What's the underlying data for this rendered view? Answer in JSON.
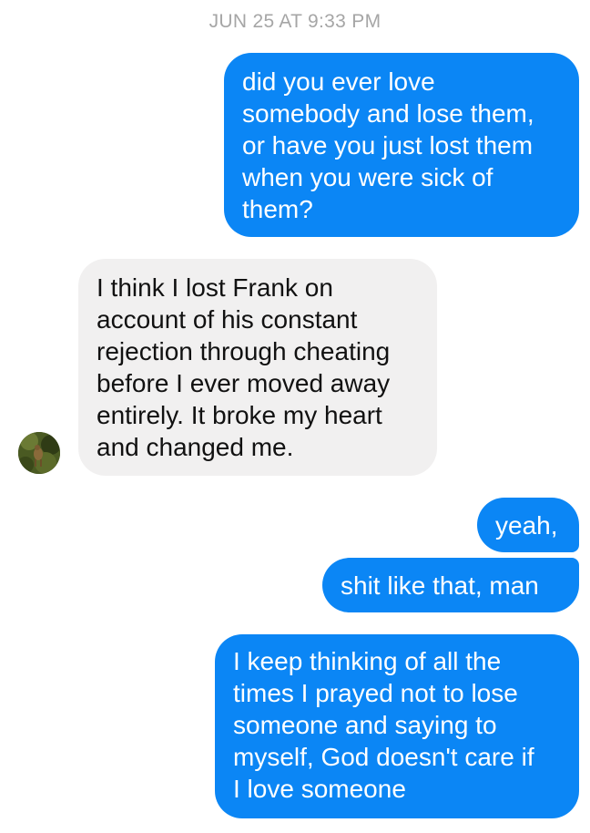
{
  "conversation": {
    "timestamp": "JUN 25 AT 9:33 PM",
    "messages": [
      {
        "sender": "me",
        "lines": [
          "did you ever love",
          "somebody and lose them,",
          "or have you just lost them",
          "when you were sick of",
          "them?"
        ]
      },
      {
        "sender": "them",
        "lines": [
          "I think I lost Frank on",
          "account of his constant",
          "rejection through cheating",
          "before I ever moved away",
          "entirely. It broke my heart",
          "and changed me."
        ]
      },
      {
        "sender": "me",
        "lines": [
          "yeah,"
        ]
      },
      {
        "sender": "me",
        "lines": [
          "shit like that, man"
        ]
      },
      {
        "sender": "me",
        "lines": [
          "I keep thinking of all the",
          "times I prayed not to lose",
          "someone and saying to",
          "myself, God doesn't care if",
          "I love someone"
        ]
      }
    ]
  },
  "colors": {
    "outgoing_bubble": "#0b86f5",
    "incoming_bubble": "#f1f0f0",
    "timestamp_text": "#a6a6a6"
  },
  "icons": {
    "avatar": "contact-avatar-photo"
  }
}
